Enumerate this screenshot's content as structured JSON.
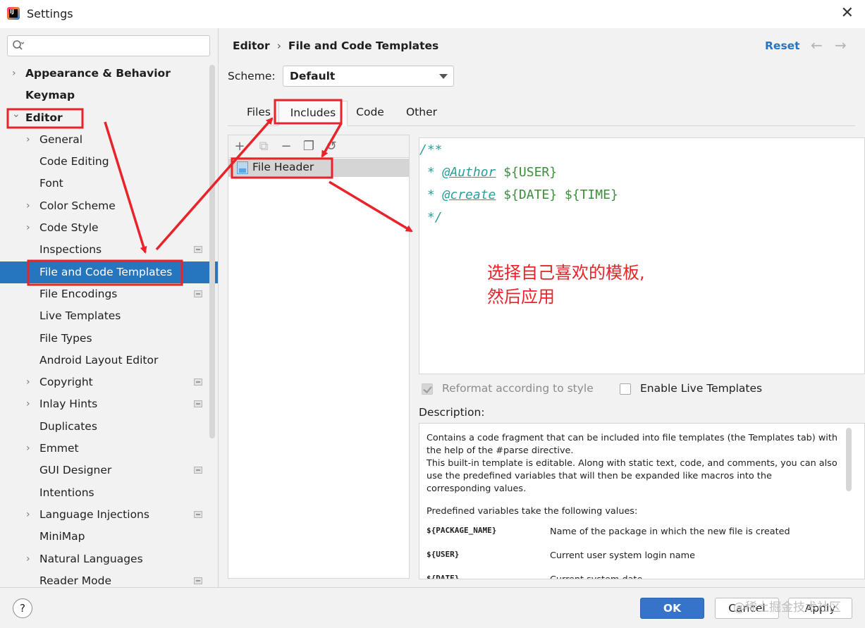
{
  "window": {
    "title": "Settings"
  },
  "search": {
    "placeholder": ""
  },
  "sidebar": {
    "items": [
      {
        "label": "Appearance & Behavior",
        "level": 0,
        "expandable": true,
        "bold": true
      },
      {
        "label": "Keymap",
        "level": 0,
        "expandable": false,
        "bold": true
      },
      {
        "label": "Editor",
        "level": 0,
        "expandable": true,
        "expanded": true,
        "bold": true
      },
      {
        "label": "General",
        "level": 1,
        "expandable": true
      },
      {
        "label": "Code Editing",
        "level": 1,
        "expandable": false
      },
      {
        "label": "Font",
        "level": 1,
        "expandable": false
      },
      {
        "label": "Color Scheme",
        "level": 1,
        "expandable": true
      },
      {
        "label": "Code Style",
        "level": 1,
        "expandable": true
      },
      {
        "label": "Inspections",
        "level": 1,
        "expandable": false,
        "project_icon": true
      },
      {
        "label": "File and Code Templates",
        "level": 1,
        "expandable": false,
        "selected": true
      },
      {
        "label": "File Encodings",
        "level": 1,
        "expandable": false,
        "project_icon": true
      },
      {
        "label": "Live Templates",
        "level": 1,
        "expandable": false
      },
      {
        "label": "File Types",
        "level": 1,
        "expandable": false
      },
      {
        "label": "Android Layout Editor",
        "level": 1,
        "expandable": false
      },
      {
        "label": "Copyright",
        "level": 1,
        "expandable": true,
        "project_icon": true
      },
      {
        "label": "Inlay Hints",
        "level": 1,
        "expandable": true,
        "project_icon": true
      },
      {
        "label": "Duplicates",
        "level": 1,
        "expandable": false
      },
      {
        "label": "Emmet",
        "level": 1,
        "expandable": true
      },
      {
        "label": "GUI Designer",
        "level": 1,
        "expandable": false,
        "project_icon": true
      },
      {
        "label": "Intentions",
        "level": 1,
        "expandable": false
      },
      {
        "label": "Language Injections",
        "level": 1,
        "expandable": true,
        "project_icon": true
      },
      {
        "label": "MiniMap",
        "level": 1,
        "expandable": false
      },
      {
        "label": "Natural Languages",
        "level": 1,
        "expandable": true
      },
      {
        "label": "Reader Mode",
        "level": 1,
        "expandable": false,
        "project_icon": true
      }
    ]
  },
  "header": {
    "breadcrumb_root": "Editor",
    "breadcrumb_sep": "›",
    "breadcrumb_page": "File and Code Templates",
    "reset": "Reset",
    "back_icon": "←",
    "forward_icon": "→"
  },
  "scheme": {
    "label": "Scheme:",
    "value": "Default"
  },
  "tabs": [
    {
      "label": "Files",
      "active": false
    },
    {
      "label": "Includes",
      "active": true
    },
    {
      "label": "Code",
      "active": false
    },
    {
      "label": "Other",
      "active": false
    }
  ],
  "template_list": {
    "toolbar": {
      "add": "+",
      "copy_disabled": "⧉",
      "remove": "−",
      "duplicate": "❐",
      "reset": "↺"
    },
    "items": [
      {
        "label": "File Header"
      }
    ]
  },
  "editor": {
    "line1": "/**",
    "line2_star": " * ",
    "line2_tag": "@Author",
    "line2_vars": "${USER}",
    "line3_star": " * ",
    "line3_tag": "@create",
    "line3_var1": "${DATE}",
    "line3_var2": "${TIME}",
    "line4": " */",
    "annotation_line1": "选择自己喜欢的模板,",
    "annotation_line2": "然后应用"
  },
  "options": {
    "reformat": {
      "label": "Reformat according to style",
      "checked": true,
      "enabled": false
    },
    "live_templates": {
      "label": "Enable Live Templates",
      "checked": false,
      "enabled": true
    }
  },
  "description": {
    "label": "Description:",
    "para1": "Contains a code fragment that can be included into file templates (the Templates tab) with the help of the #parse directive.",
    "para2": "This built-in template is editable. Along with static text, code, and comments, you can also use the predefined variables that will then be expanded like macros into the corresponding values.",
    "para3": "Predefined variables take the following values:",
    "variables": [
      {
        "name": "${PACKAGE_NAME}",
        "desc": "Name of the package in which the new file is created"
      },
      {
        "name": "${USER}",
        "desc": "Current user system login name"
      },
      {
        "name": "${DATE}",
        "desc": "Current system date"
      }
    ]
  },
  "buttons": {
    "help": "?",
    "ok": "OK",
    "cancel": "Cancel",
    "apply": "Apply"
  },
  "watermark": "@稀土掘金技术社区",
  "colors": {
    "accent": "#2675bf",
    "selection": "#2675bf",
    "annotation_red": "#e8232a",
    "code_comment": "#2b9e9a"
  }
}
